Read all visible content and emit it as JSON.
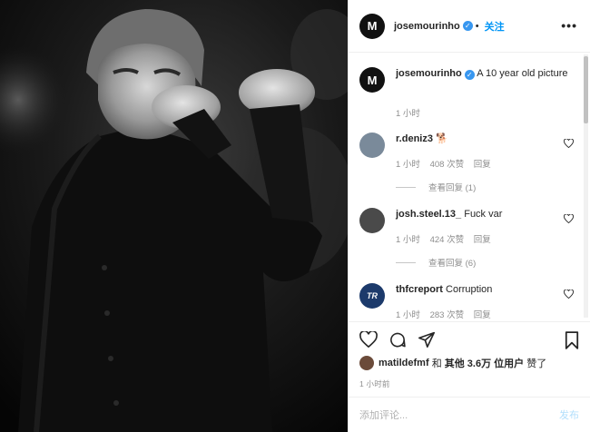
{
  "header": {
    "username": "josemourinho",
    "follow_label": "关注",
    "more_label": "•••",
    "dot": "•",
    "avatar_letter": "M"
  },
  "caption": {
    "username": "josemourinho",
    "text": "A 10 year old picture",
    "time": "1 小时",
    "avatar_letter": "M"
  },
  "comments": [
    {
      "username": "r.deniz3",
      "text": "🐕",
      "time": "1 小时",
      "likes": "408 次赞",
      "reply_label": "回复",
      "view_replies": "查看回复 (1)"
    },
    {
      "username": "josh.steel.13_",
      "text": "Fuck var",
      "time": "1 小时",
      "likes": "424 次赞",
      "reply_label": "回复",
      "view_replies": "查看回复 (6)"
    },
    {
      "username": "thfcreport",
      "text": "Corruption",
      "time": "1 小时",
      "likes": "283 次赞",
      "reply_label": "回复",
      "avatar_letter": "TR"
    }
  ],
  "likes_line": {
    "user": "matildefmf",
    "and": "和",
    "others": "其他 3.6万 位用户",
    "suffix": "赞了"
  },
  "post_time": "1 小时前",
  "add_comment": {
    "placeholder": "添加评论...",
    "post_label": "发布"
  },
  "colors": {
    "accent": "#0095f6",
    "verified": "#3897f0",
    "muted": "#8e8e8e"
  },
  "icons": [
    "heart-icon",
    "comment-icon",
    "share-icon",
    "bookmark-icon",
    "verified-icon",
    "more-icon"
  ]
}
